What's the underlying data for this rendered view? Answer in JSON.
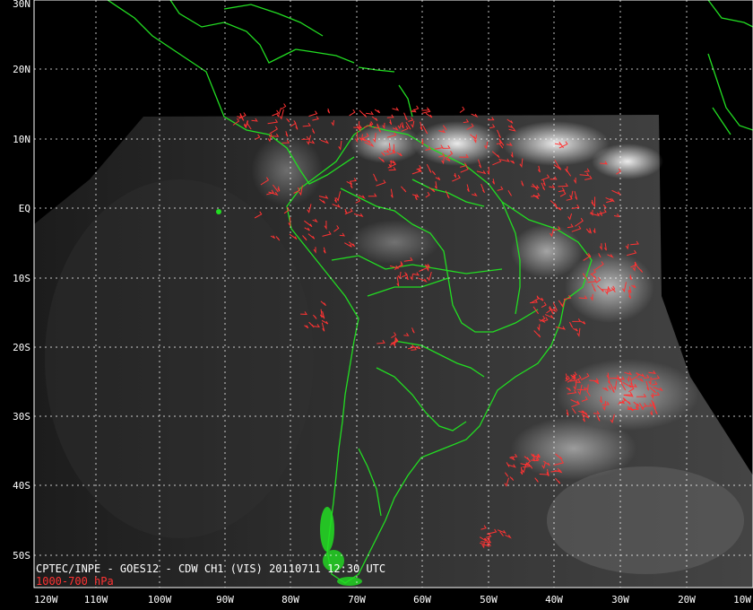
{
  "caption": {
    "line1": "CPTEC/INPE - GOES12 - CDW CH1 (VIS) 20110711 12:30 UTC",
    "line2": "1000-700 hPa"
  },
  "colors": {
    "background": "#000000",
    "coastline": "#22dd22",
    "wind_vectors": "#ff3333",
    "grid": "#ffffff",
    "caption_line1": "#ffffff",
    "caption_line2": "#ff3333"
  },
  "latitude_labels": [
    "30N",
    "20N",
    "10N",
    "EQ",
    "10S",
    "20S",
    "30S",
    "40S",
    "50S"
  ],
  "longitude_labels": [
    "120W",
    "110W",
    "100W",
    "90W",
    "80W",
    "70W",
    "60W",
    "50W",
    "40W",
    "30W",
    "20W",
    "10W"
  ]
}
